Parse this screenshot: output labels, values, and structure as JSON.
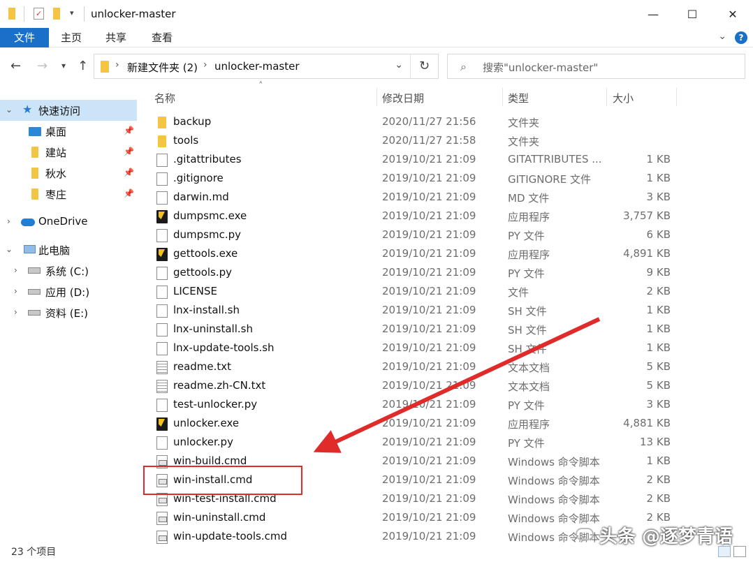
{
  "window": {
    "title": "unlocker-master",
    "minimize": "—",
    "maximize": "☐",
    "close": "✕"
  },
  "ribbon": {
    "tabs": [
      "文件",
      "主页",
      "共享",
      "查看"
    ],
    "help": "?"
  },
  "address": {
    "crumbs": [
      "新建文件夹 (2)",
      "unlocker-master"
    ],
    "search_placeholder": "搜索\"unlocker-master\""
  },
  "sidebar": {
    "quick_access": "快速访问",
    "pinned": [
      "桌面",
      "建站",
      "秋水",
      "枣庄"
    ],
    "onedrive": "OneDrive",
    "this_pc": "此电脑",
    "drives": [
      "系统 (C:)",
      "应用 (D:)",
      "资料 (E:)"
    ]
  },
  "columns": {
    "name": "名称",
    "date": "修改日期",
    "type": "类型",
    "size": "大小"
  },
  "files": [
    {
      "name": "backup",
      "date": "2020/11/27 21:56",
      "type": "文件夹",
      "size": "",
      "icon": "folder"
    },
    {
      "name": "tools",
      "date": "2020/11/27 21:58",
      "type": "文件夹",
      "size": "",
      "icon": "folder"
    },
    {
      "name": ".gitattributes",
      "date": "2019/10/21 21:09",
      "type": "GITATTRIBUTES ...",
      "size": "1 KB",
      "icon": "file"
    },
    {
      "name": ".gitignore",
      "date": "2019/10/21 21:09",
      "type": "GITIGNORE 文件",
      "size": "1 KB",
      "icon": "file"
    },
    {
      "name": "darwin.md",
      "date": "2019/10/21 21:09",
      "type": "MD 文件",
      "size": "3 KB",
      "icon": "file"
    },
    {
      "name": "dumpsmc.exe",
      "date": "2019/10/21 21:09",
      "type": "应用程序",
      "size": "3,757 KB",
      "icon": "exe"
    },
    {
      "name": "dumpsmc.py",
      "date": "2019/10/21 21:09",
      "type": "PY 文件",
      "size": "6 KB",
      "icon": "file"
    },
    {
      "name": "gettools.exe",
      "date": "2019/10/21 21:09",
      "type": "应用程序",
      "size": "4,891 KB",
      "icon": "exe"
    },
    {
      "name": "gettools.py",
      "date": "2019/10/21 21:09",
      "type": "PY 文件",
      "size": "9 KB",
      "icon": "file"
    },
    {
      "name": "LICENSE",
      "date": "2019/10/21 21:09",
      "type": "文件",
      "size": "2 KB",
      "icon": "file"
    },
    {
      "name": "lnx-install.sh",
      "date": "2019/10/21 21:09",
      "type": "SH 文件",
      "size": "1 KB",
      "icon": "file"
    },
    {
      "name": "lnx-uninstall.sh",
      "date": "2019/10/21 21:09",
      "type": "SH 文件",
      "size": "1 KB",
      "icon": "file"
    },
    {
      "name": "lnx-update-tools.sh",
      "date": "2019/10/21 21:09",
      "type": "SH 文件",
      "size": "1 KB",
      "icon": "file"
    },
    {
      "name": "readme.txt",
      "date": "2019/10/21 21:09",
      "type": "文本文档",
      "size": "5 KB",
      "icon": "txt"
    },
    {
      "name": "readme.zh-CN.txt",
      "date": "2019/10/21 21:09",
      "type": "文本文档",
      "size": "5 KB",
      "icon": "txt"
    },
    {
      "name": "test-unlocker.py",
      "date": "2019/10/21 21:09",
      "type": "PY 文件",
      "size": "3 KB",
      "icon": "file"
    },
    {
      "name": "unlocker.exe",
      "date": "2019/10/21 21:09",
      "type": "应用程序",
      "size": "4,881 KB",
      "icon": "exe"
    },
    {
      "name": "unlocker.py",
      "date": "2019/10/21 21:09",
      "type": "PY 文件",
      "size": "13 KB",
      "icon": "file"
    },
    {
      "name": "win-build.cmd",
      "date": "2019/10/21 21:09",
      "type": "Windows 命令脚本",
      "size": "1 KB",
      "icon": "cmd"
    },
    {
      "name": "win-install.cmd",
      "date": "2019/10/21 21:09",
      "type": "Windows 命令脚本",
      "size": "2 KB",
      "icon": "cmd"
    },
    {
      "name": "win-test-install.cmd",
      "date": "2019/10/21 21:09",
      "type": "Windows 命令脚本",
      "size": "2 KB",
      "icon": "cmd"
    },
    {
      "name": "win-uninstall.cmd",
      "date": "2019/10/21 21:09",
      "type": "Windows 命令脚本",
      "size": "2 KB",
      "icon": "cmd"
    },
    {
      "name": "win-update-tools.cmd",
      "date": "2019/10/21 21:09",
      "type": "Windows 命令脚本",
      "size": "",
      "icon": "cmd"
    }
  ],
  "status": {
    "count": "23 个项目"
  },
  "watermark": "头条 @逐梦青语",
  "colors": {
    "accent": "#1a6fc9",
    "selection": "#cce4f7",
    "annotation": "#e02b2b"
  }
}
